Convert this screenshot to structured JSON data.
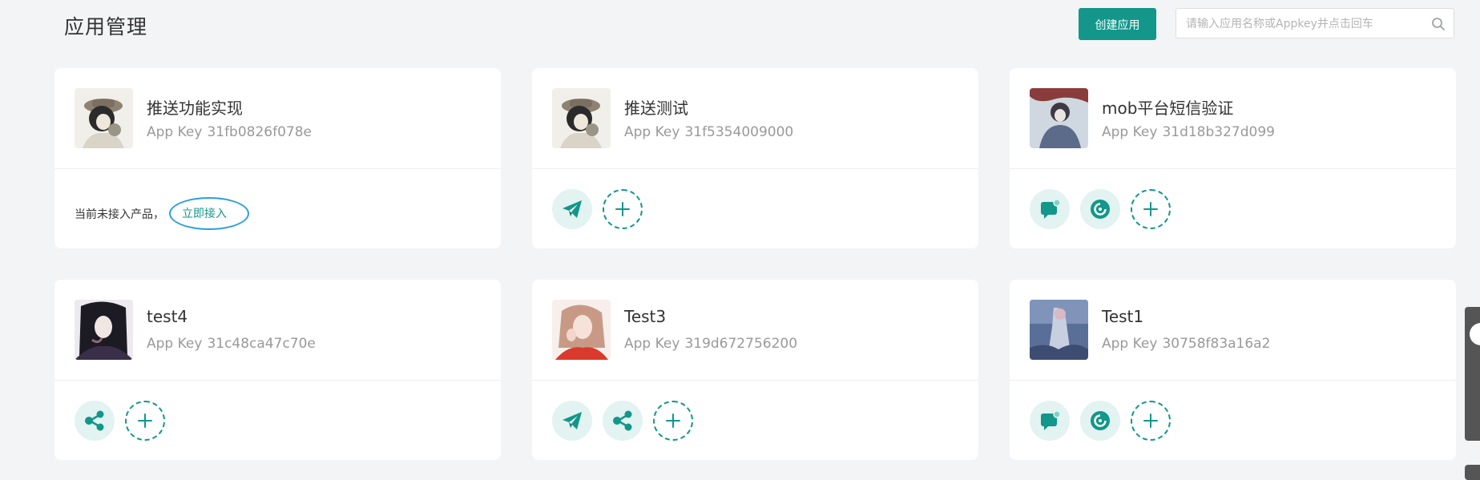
{
  "page": {
    "title": "应用管理"
  },
  "toolbar": {
    "create_label": "创建应用",
    "search_placeholder": "请输入应用名称或Appkey并点击回车",
    "search_value": ""
  },
  "key_label": "App Key",
  "empty_text": "当前未接入产品，",
  "connect_label": "立即接入",
  "accent_color": "#12978a",
  "apps": [
    {
      "name": "推送功能实现",
      "app_key": "31fb0826f078e",
      "products": []
    },
    {
      "name": "推送测试",
      "app_key": "31f5354009000",
      "products": [
        "push-icon"
      ]
    },
    {
      "name": "mob平台短信验证",
      "app_key": "31d18b327d099",
      "products": [
        "sms-icon",
        "verify-icon"
      ]
    },
    {
      "name": "test4",
      "app_key": "31c48ca47c70e",
      "products": [
        "share-icon"
      ]
    },
    {
      "name": "Test3",
      "app_key": "319d672756200",
      "products": [
        "push-icon",
        "share-icon"
      ]
    },
    {
      "name": "Test1",
      "app_key": "30758f83a16a2",
      "products": [
        "sms-icon",
        "verify-icon"
      ]
    }
  ]
}
